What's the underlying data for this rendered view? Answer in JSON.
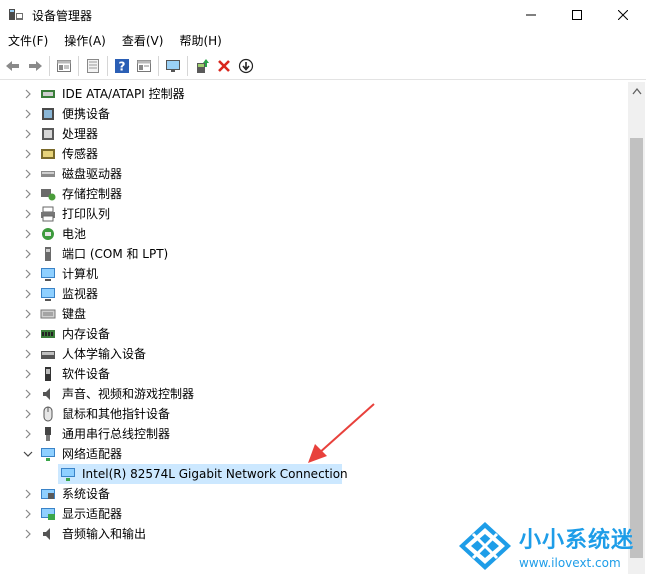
{
  "window": {
    "title": "设备管理器"
  },
  "menu": [
    {
      "label": "文件(F)"
    },
    {
      "label": "操作(A)"
    },
    {
      "label": "查看(V)"
    },
    {
      "label": "帮助(H)"
    }
  ],
  "toolbar": {
    "icons": [
      "back-icon",
      "forward-icon",
      "properties-icon",
      "view-icon",
      "help-icon",
      "view-list-icon",
      "monitor-icon",
      "update-driver-icon",
      "uninstall-icon",
      "scan-icon"
    ]
  },
  "tree": {
    "items": [
      {
        "label": "IDE ATA/ATAPI 控制器",
        "icon": "ide-controller-icon",
        "expanded": false
      },
      {
        "label": "便携设备",
        "icon": "portable-device-icon",
        "expanded": false
      },
      {
        "label": "处理器",
        "icon": "processor-icon",
        "expanded": false
      },
      {
        "label": "传感器",
        "icon": "sensor-icon",
        "expanded": false
      },
      {
        "label": "磁盘驱动器",
        "icon": "disk-drive-icon",
        "expanded": false
      },
      {
        "label": "存储控制器",
        "icon": "storage-controller-icon",
        "expanded": false
      },
      {
        "label": "打印队列",
        "icon": "printer-icon",
        "expanded": false
      },
      {
        "label": "电池",
        "icon": "battery-icon",
        "expanded": false
      },
      {
        "label": "端口 (COM 和 LPT)",
        "icon": "port-icon",
        "expanded": false
      },
      {
        "label": "计算机",
        "icon": "computer-icon",
        "expanded": false
      },
      {
        "label": "监视器",
        "icon": "monitor-icon",
        "expanded": false
      },
      {
        "label": "键盘",
        "icon": "keyboard-icon",
        "expanded": false
      },
      {
        "label": "内存设备",
        "icon": "memory-icon",
        "expanded": false
      },
      {
        "label": "人体学输入设备",
        "icon": "hid-icon",
        "expanded": false
      },
      {
        "label": "软件设备",
        "icon": "software-device-icon",
        "expanded": false
      },
      {
        "label": "声音、视频和游戏控制器",
        "icon": "sound-icon",
        "expanded": false
      },
      {
        "label": "鼠标和其他指针设备",
        "icon": "mouse-icon",
        "expanded": false
      },
      {
        "label": "通用串行总线控制器",
        "icon": "usb-icon",
        "expanded": false
      },
      {
        "label": "网络适配器",
        "icon": "network-adapter-icon",
        "expanded": true
      },
      {
        "label": "Intel(R) 82574L Gigabit Network Connection",
        "icon": "network-adapter-icon",
        "child": true,
        "selected": true
      },
      {
        "label": "系统设备",
        "icon": "system-device-icon",
        "expanded": false
      },
      {
        "label": "显示适配器",
        "icon": "display-adapter-icon",
        "expanded": false
      },
      {
        "label": "音频输入和输出",
        "icon": "audio-io-icon",
        "expanded": false
      }
    ]
  },
  "watermark": {
    "brand": "小小系统迷",
    "url": "www.ilovext.com"
  },
  "colors": {
    "selection": "#cce8ff",
    "annotation_arrow": "#e8413c",
    "watermark": "#1e9de8"
  }
}
